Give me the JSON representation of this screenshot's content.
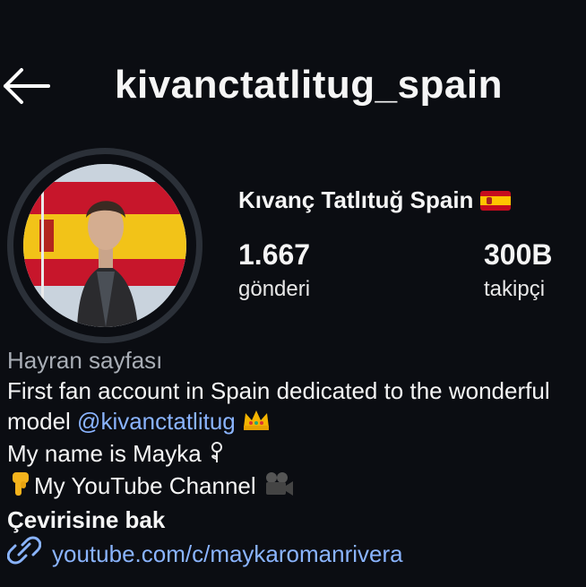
{
  "header": {
    "username": "kivanctatlitug_spain"
  },
  "profile": {
    "display_name": "Kıvanç Tatlıtuğ Spain",
    "stats": [
      {
        "value": "1.667",
        "label": "gönderi"
      },
      {
        "value": "300B",
        "label": "takipçi"
      }
    ]
  },
  "bio": {
    "category": "Hayran sayfası",
    "line1": "First fan account in Spain dedicated to the wonderful",
    "line2_prefix": "model ",
    "mention": "@kivanctatlitug",
    "line3": "My name is Mayka ",
    "line4": "My YouTube Channel ",
    "translate_label": "Çevirisine bak",
    "link": "youtube.com/c/maykaromanrivera"
  },
  "colors": {
    "background": "#0b0d12",
    "link": "#8ab4ff",
    "muted": "#a9aeb6"
  }
}
